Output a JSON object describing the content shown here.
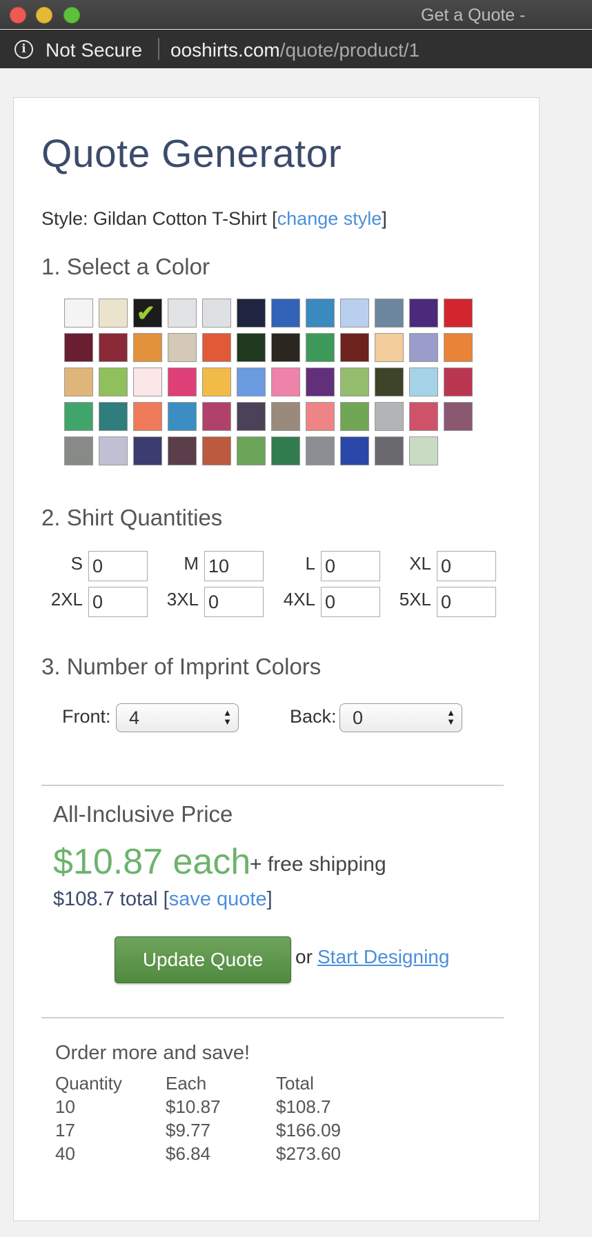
{
  "window": {
    "title": "Get a Quote -"
  },
  "urlbar": {
    "security": "Not Secure",
    "host": "ooshirts.com",
    "path": "/quote/product/1"
  },
  "page": {
    "title": "Quote Generator",
    "style_prefix": "Style: Gildan Cotton T-Shirt [",
    "change_style": "change style",
    "style_suffix": "]"
  },
  "colors": {
    "heading": "1. Select a Color",
    "selected_index": 2,
    "swatches": [
      "#f4f4f4",
      "#ebe4cc",
      "#1c1c1c",
      "#e2e3e5",
      "#dfe0e4",
      "#1f2440",
      "#3263b8",
      "#3a8ac0",
      "#b8cff0",
      "#6d87a0",
      "#4b2a7c",
      "#d2262f",
      "#6a1e32",
      "#8a2a39",
      "#e0913a",
      "#d3c9b6",
      "#e05a37",
      "#1f3a1f",
      "#2b2720",
      "#3e9a5b",
      "#6d221e",
      "#f3cc9b",
      "#9a9ccc",
      "#e98337",
      "#dfb57a",
      "#8fc05c",
      "#fbe6e8",
      "#de3f76",
      "#f2bb48",
      "#6a9be0",
      "#ee82a8",
      "#62307a",
      "#94bd6d",
      "#3d4429",
      "#a6d2e8",
      "#bb3650",
      "#3fa56a",
      "#2f7d7d",
      "#ef7b5a",
      "#3a8ec2",
      "#b04269",
      "#4b4158",
      "#9a8a7c",
      "#ef8486",
      "#71a655",
      "#b3b4b6",
      "#cf5368",
      "#8a5870",
      "#888a88",
      "#bfc0d4",
      "#3c3c70",
      "#5a3e4a",
      "#bb5a3e",
      "#6ba55a",
      "#317d4f",
      "#8b8e93",
      "#2a48a8",
      "#6a6a6e",
      "#c9dcc3"
    ]
  },
  "quantities": {
    "heading": "2. Shirt Quantities",
    "sizes": [
      {
        "label": "S",
        "value": "0"
      },
      {
        "label": "M",
        "value": "10"
      },
      {
        "label": "L",
        "value": "0"
      },
      {
        "label": "XL",
        "value": "0"
      },
      {
        "label": "2XL",
        "value": "0"
      },
      {
        "label": "3XL",
        "value": "0"
      },
      {
        "label": "4XL",
        "value": "0"
      },
      {
        "label": "5XL",
        "value": "0"
      }
    ]
  },
  "imprint": {
    "heading": "3. Number of Imprint Colors",
    "front_label": "Front:",
    "front_value": "4",
    "back_label": "Back:",
    "back_value": "0"
  },
  "price": {
    "title": "All-Inclusive Price",
    "each": "$10.87 each",
    "shipping": "+ free shipping",
    "total": "$108.7 total",
    "save_quote": "save quote",
    "update_button": "Update Quote",
    "or": "or",
    "start_designing": "Start Designing"
  },
  "order_more": {
    "title": "Order more and save!",
    "headers": [
      "Quantity",
      "Each",
      "Total"
    ],
    "rows": [
      [
        "10",
        "$10.87",
        "$108.7"
      ],
      [
        "17",
        "$9.77",
        "$166.09"
      ],
      [
        "40",
        "$6.84",
        "$273.60"
      ]
    ]
  }
}
